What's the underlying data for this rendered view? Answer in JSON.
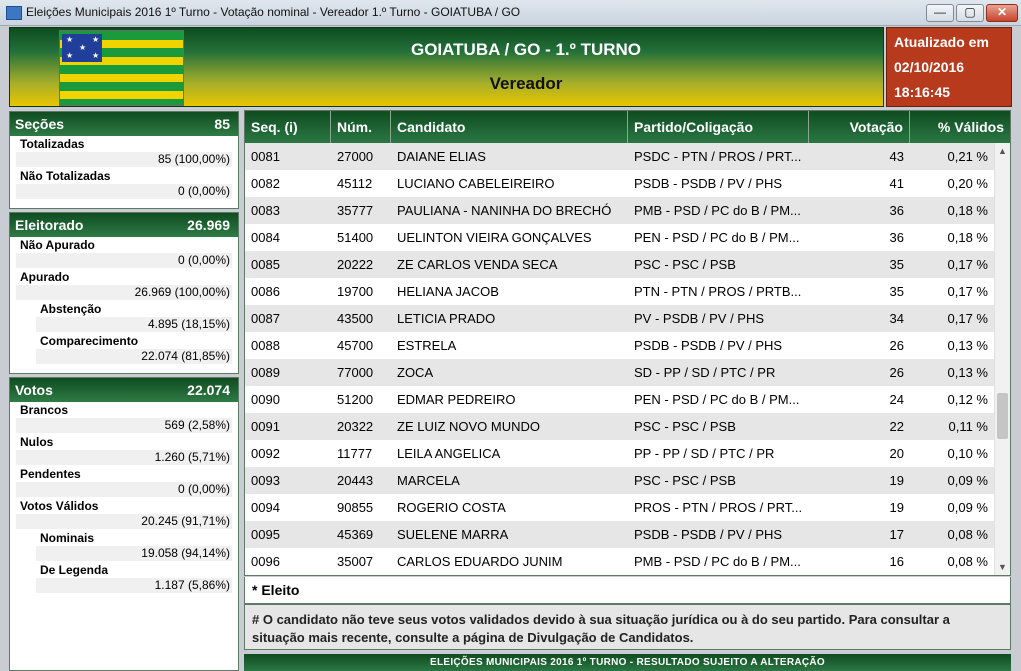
{
  "window": {
    "title": "Eleições Municipais 2016 1º Turno - Votação nominal - Vereador 1.º Turno - GOIATUBA / GO",
    "minimize_glyph": "—",
    "maximize_glyph": "▢",
    "close_glyph": "✕"
  },
  "header": {
    "city_round": "GOIATUBA / GO - 1.º TURNO",
    "office": "Vereador",
    "flag_icon": "goias-flag-icon"
  },
  "updated": {
    "label": "Atualizado em",
    "date": "02/10/2016",
    "time": "18:16:45"
  },
  "secoes": {
    "label": "Seções",
    "total": "85",
    "totalizadas": {
      "label": "Totalizadas",
      "value": "85 (100,00%)"
    },
    "nao_totalizadas": {
      "label": "Não Totalizadas",
      "value": "0 (0,00%)"
    }
  },
  "eleitorado": {
    "label": "Eleitorado",
    "total": "26.969",
    "nao_apurado": {
      "label": "Não Apurado",
      "value": "0 (0,00%)"
    },
    "apurado": {
      "label": "Apurado",
      "value": "26.969 (100,00%)"
    },
    "abstencao": {
      "label": "Abstenção",
      "value": "4.895 (18,15%)"
    },
    "comparecimento": {
      "label": "Comparecimento",
      "value": "22.074 (81,85%)"
    }
  },
  "votos": {
    "label": "Votos",
    "total": "22.074",
    "brancos": {
      "label": "Brancos",
      "value": "569 (2,58%)"
    },
    "nulos": {
      "label": "Nulos",
      "value": "1.260 (5,71%)"
    },
    "pendentes": {
      "label": "Pendentes",
      "value": "0 (0,00%)"
    },
    "validos": {
      "label": "Votos Válidos",
      "value": "20.245 (91,71%)"
    },
    "nominais": {
      "label": "Nominais",
      "value": "19.058 (94,14%)"
    },
    "legenda": {
      "label": "De Legenda",
      "value": "1.187 (5,86%)"
    }
  },
  "table": {
    "headers": {
      "seq": "Seq.  (i)",
      "num": "Núm.",
      "candidato": "Candidato",
      "partido": "Partido/Coligação",
      "votacao": "Votação",
      "pct": "% Válidos"
    },
    "rows": [
      {
        "seq": "0081",
        "num": "27000",
        "candidato": "DAIANE ELIAS",
        "partido": "PSDC - PTN / PROS / PRT...",
        "votacao": "43",
        "pct": "0,21 %"
      },
      {
        "seq": "0082",
        "num": "45112",
        "candidato": "LUCIANO CABELEIREIRO",
        "partido": "PSDB - PSDB / PV / PHS",
        "votacao": "41",
        "pct": "0,20 %"
      },
      {
        "seq": "0083",
        "num": "35777",
        "candidato": "PAULIANA - NANINHA DO BRECHÓ",
        "partido": "PMB - PSD / PC do B / PM...",
        "votacao": "36",
        "pct": "0,18 %"
      },
      {
        "seq": "0084",
        "num": "51400",
        "candidato": "UELINTON VIEIRA GONÇALVES",
        "partido": "PEN - PSD / PC do B / PM...",
        "votacao": "36",
        "pct": "0,18 %"
      },
      {
        "seq": "0085",
        "num": "20222",
        "candidato": "ZE CARLOS VENDA SECA",
        "partido": "PSC - PSC / PSB",
        "votacao": "35",
        "pct": "0,17 %"
      },
      {
        "seq": "0086",
        "num": "19700",
        "candidato": "HELIANA JACOB",
        "partido": "PTN - PTN / PROS / PRTB...",
        "votacao": "35",
        "pct": "0,17 %"
      },
      {
        "seq": "0087",
        "num": "43500",
        "candidato": "LETICIA PRADO",
        "partido": "PV - PSDB / PV / PHS",
        "votacao": "34",
        "pct": "0,17 %"
      },
      {
        "seq": "0088",
        "num": "45700",
        "candidato": "ESTRELA",
        "partido": "PSDB - PSDB / PV / PHS",
        "votacao": "26",
        "pct": "0,13 %"
      },
      {
        "seq": "0089",
        "num": "77000",
        "candidato": "ZOCA",
        "partido": "SD - PP / SD / PTC / PR",
        "votacao": "26",
        "pct": "0,13 %"
      },
      {
        "seq": "0090",
        "num": "51200",
        "candidato": "EDMAR PEDREIRO",
        "partido": "PEN - PSD / PC do B / PM...",
        "votacao": "24",
        "pct": "0,12 %"
      },
      {
        "seq": "0091",
        "num": "20322",
        "candidato": "ZE LUIZ NOVO MUNDO",
        "partido": "PSC - PSC / PSB",
        "votacao": "22",
        "pct": "0,11 %"
      },
      {
        "seq": "0092",
        "num": "11777",
        "candidato": "LEILA ANGELICA",
        "partido": "PP - PP / SD / PTC / PR",
        "votacao": "20",
        "pct": "0,10 %"
      },
      {
        "seq": "0093",
        "num": "20443",
        "candidato": "MARCELA",
        "partido": "PSC - PSC / PSB",
        "votacao": "19",
        "pct": "0,09 %"
      },
      {
        "seq": "0094",
        "num": "90855",
        "candidato": "ROGERIO COSTA",
        "partido": "PROS - PTN / PROS / PRT...",
        "votacao": "19",
        "pct": "0,09 %"
      },
      {
        "seq": "0095",
        "num": "45369",
        "candidato": "SUELENE MARRA",
        "partido": "PSDB - PSDB / PV / PHS",
        "votacao": "17",
        "pct": "0,08 %"
      },
      {
        "seq": "0096",
        "num": "35007",
        "candidato": "CARLOS EDUARDO JUNIM",
        "partido": "PMB - PSD / PC do B / PM...",
        "votacao": "16",
        "pct": "0,08 %"
      }
    ]
  },
  "notes": {
    "eleito": "* Eleito",
    "invalid": "# O candidato não teve seus votos validados devido à sua situação jurídica ou à do seu partido. Para consultar a situação mais recente, consulte a página de Divulgação de Candidatos."
  },
  "footer": "ELEIÇÕES MUNICIPAIS 2016 1º TURNO - RESULTADO SUJEITO A ALTERAÇÃO",
  "scrollbar": {
    "up_glyph": "▲",
    "down_glyph": "▼"
  }
}
